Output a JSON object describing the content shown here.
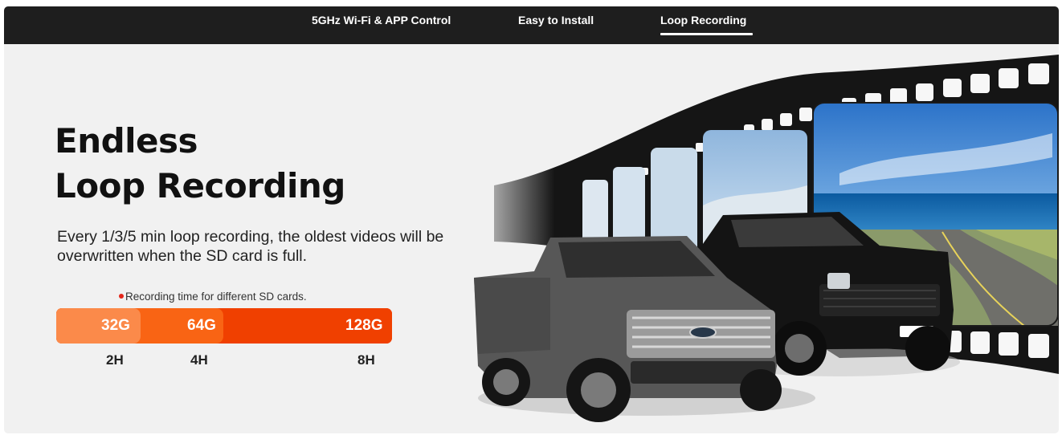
{
  "nav": {
    "tabs": [
      {
        "label": "5GHz Wi-Fi & APP Control"
      },
      {
        "label": "Easy to Install"
      },
      {
        "label": "Loop Recording",
        "active": true
      }
    ]
  },
  "hero": {
    "title_line1": "Endless",
    "title_line2": "Loop Recording",
    "description": "Every 1/3/5 min loop recording, the oldest videos will be overwritten when the SD card is full.",
    "note": "Recording time for different SD cards."
  },
  "sd_cards": [
    {
      "capacity": "32G",
      "time": "2H"
    },
    {
      "capacity": "64G",
      "time": "4H"
    },
    {
      "capacity": "128G",
      "time": "8H"
    }
  ],
  "colors": {
    "nav_bg": "#1e1e1e",
    "panel_bg": "#f1f1f1",
    "seg_32g": "#fb8a4a",
    "seg_64g": "#f96414",
    "seg_128g": "#f04000",
    "note_dot": "#e4261a"
  },
  "illustration": {
    "subject": "two pickup trucks in front of a curved film strip showing a coastal road"
  }
}
